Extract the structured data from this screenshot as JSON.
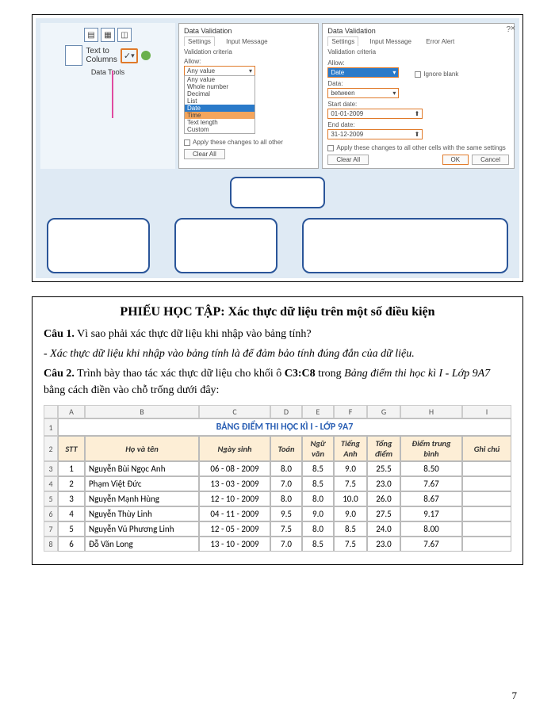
{
  "excel_ribbon": {
    "text_to_columns": "Text to\nColumns",
    "data_tools_label": "Data Tools"
  },
  "dialog1": {
    "title": "Data Validation",
    "tab_settings": "Settings",
    "tab_input": "Input Message",
    "criteria_label": "Validation criteria",
    "allow_label": "Allow:",
    "allow_value": "Any value",
    "options": [
      "Any value",
      "Whole number",
      "Decimal",
      "List",
      "Date",
      "Time",
      "Text length",
      "Custom"
    ],
    "selected_opt": "Date",
    "apply_text": "Apply these changes to all other",
    "clear_btn": "Clear All"
  },
  "dialog2": {
    "title": "Data Validation",
    "help_q": "?",
    "tab_settings": "Settings",
    "tab_input": "Input Message",
    "tab_error": "Error Alert",
    "criteria_label": "Validation criteria",
    "allow_label": "Allow:",
    "allow_value": "Date",
    "ignore_blank": "Ignore blank",
    "data_label": "Data:",
    "data_value": "between",
    "start_label": "Start date:",
    "start_value": "01-01-2009",
    "end_label": "End date:",
    "end_value": "31-12-2009",
    "apply_text": "Apply these changes to all other cells with the same settings",
    "clear_btn": "Clear All",
    "ok_btn": "OK",
    "cancel_btn": "Cancel"
  },
  "worksheet": {
    "title": "PHIẾU HỌC TẬP: Xác thực dữ liệu trên một số điều kiện",
    "q1_label": "Câu 1.",
    "q1_text": " Vì sao phải xác thực dữ liệu khi nhập vào bảng tính?",
    "a1": "- Xác thực dữ liệu khi nhập vào bảng tính là để đảm bảo tính đúng đắn của dữ liệu.",
    "q2_label": "Câu 2.",
    "q2_text_1": " Trình bày thao tác xác thực dữ liệu cho khối ô ",
    "q2_bold": "C3:C8",
    "q2_text_2": " trong ",
    "q2_italic": "Bảng điểm thi học kì I - Lớp 9A7",
    "q2_text_3": " bằng cách điền vào chỗ trống dưới đây:"
  },
  "table": {
    "col_letters": [
      "A",
      "B",
      "C",
      "D",
      "E",
      "F",
      "G",
      "H",
      "I"
    ],
    "title": "BẢNG ĐIỂM THI HỌC KÌ I - LỚP 9A7",
    "headers": [
      "STT",
      "Họ và tên",
      "Ngày sinh",
      "Toán",
      "Ngữ văn",
      "Tiếng Anh",
      "Tổng điểm",
      "Điểm trung bình",
      "Ghi chú"
    ],
    "rows": [
      {
        "stt": "1",
        "name": "Nguyễn Bùi Ngọc Anh",
        "dob": "06 - 08 - 2009",
        "toan": "8.0",
        "van": "8.5",
        "anh": "9.0",
        "tong": "25.5",
        "tb": "8.50",
        "note": ""
      },
      {
        "stt": "2",
        "name": "Phạm Việt Đức",
        "dob": "13 - 03 - 2009",
        "toan": "7.0",
        "van": "8.5",
        "anh": "7.5",
        "tong": "23.0",
        "tb": "7.67",
        "note": ""
      },
      {
        "stt": "3",
        "name": "Nguyễn Mạnh Hùng",
        "dob": "12 - 10 - 2009",
        "toan": "8.0",
        "van": "8.0",
        "anh": "10.0",
        "tong": "26.0",
        "tb": "8.67",
        "note": ""
      },
      {
        "stt": "4",
        "name": "Nguyễn Thùy Linh",
        "dob": "04 - 11 - 2009",
        "toan": "9.5",
        "van": "9.0",
        "anh": "9.0",
        "tong": "27.5",
        "tb": "9.17",
        "note": ""
      },
      {
        "stt": "5",
        "name": "Nguyễn Vũ Phương Linh",
        "dob": "12 - 05 - 2009",
        "toan": "7.5",
        "van": "8.0",
        "anh": "8.5",
        "tong": "24.0",
        "tb": "8.00",
        "note": ""
      },
      {
        "stt": "6",
        "name": "Đỗ Văn Long",
        "dob": "13 - 10 - 2009",
        "toan": "7.0",
        "van": "8.5",
        "anh": "7.5",
        "tong": "23.0",
        "tb": "7.67",
        "note": ""
      }
    ]
  },
  "page_number": "7"
}
